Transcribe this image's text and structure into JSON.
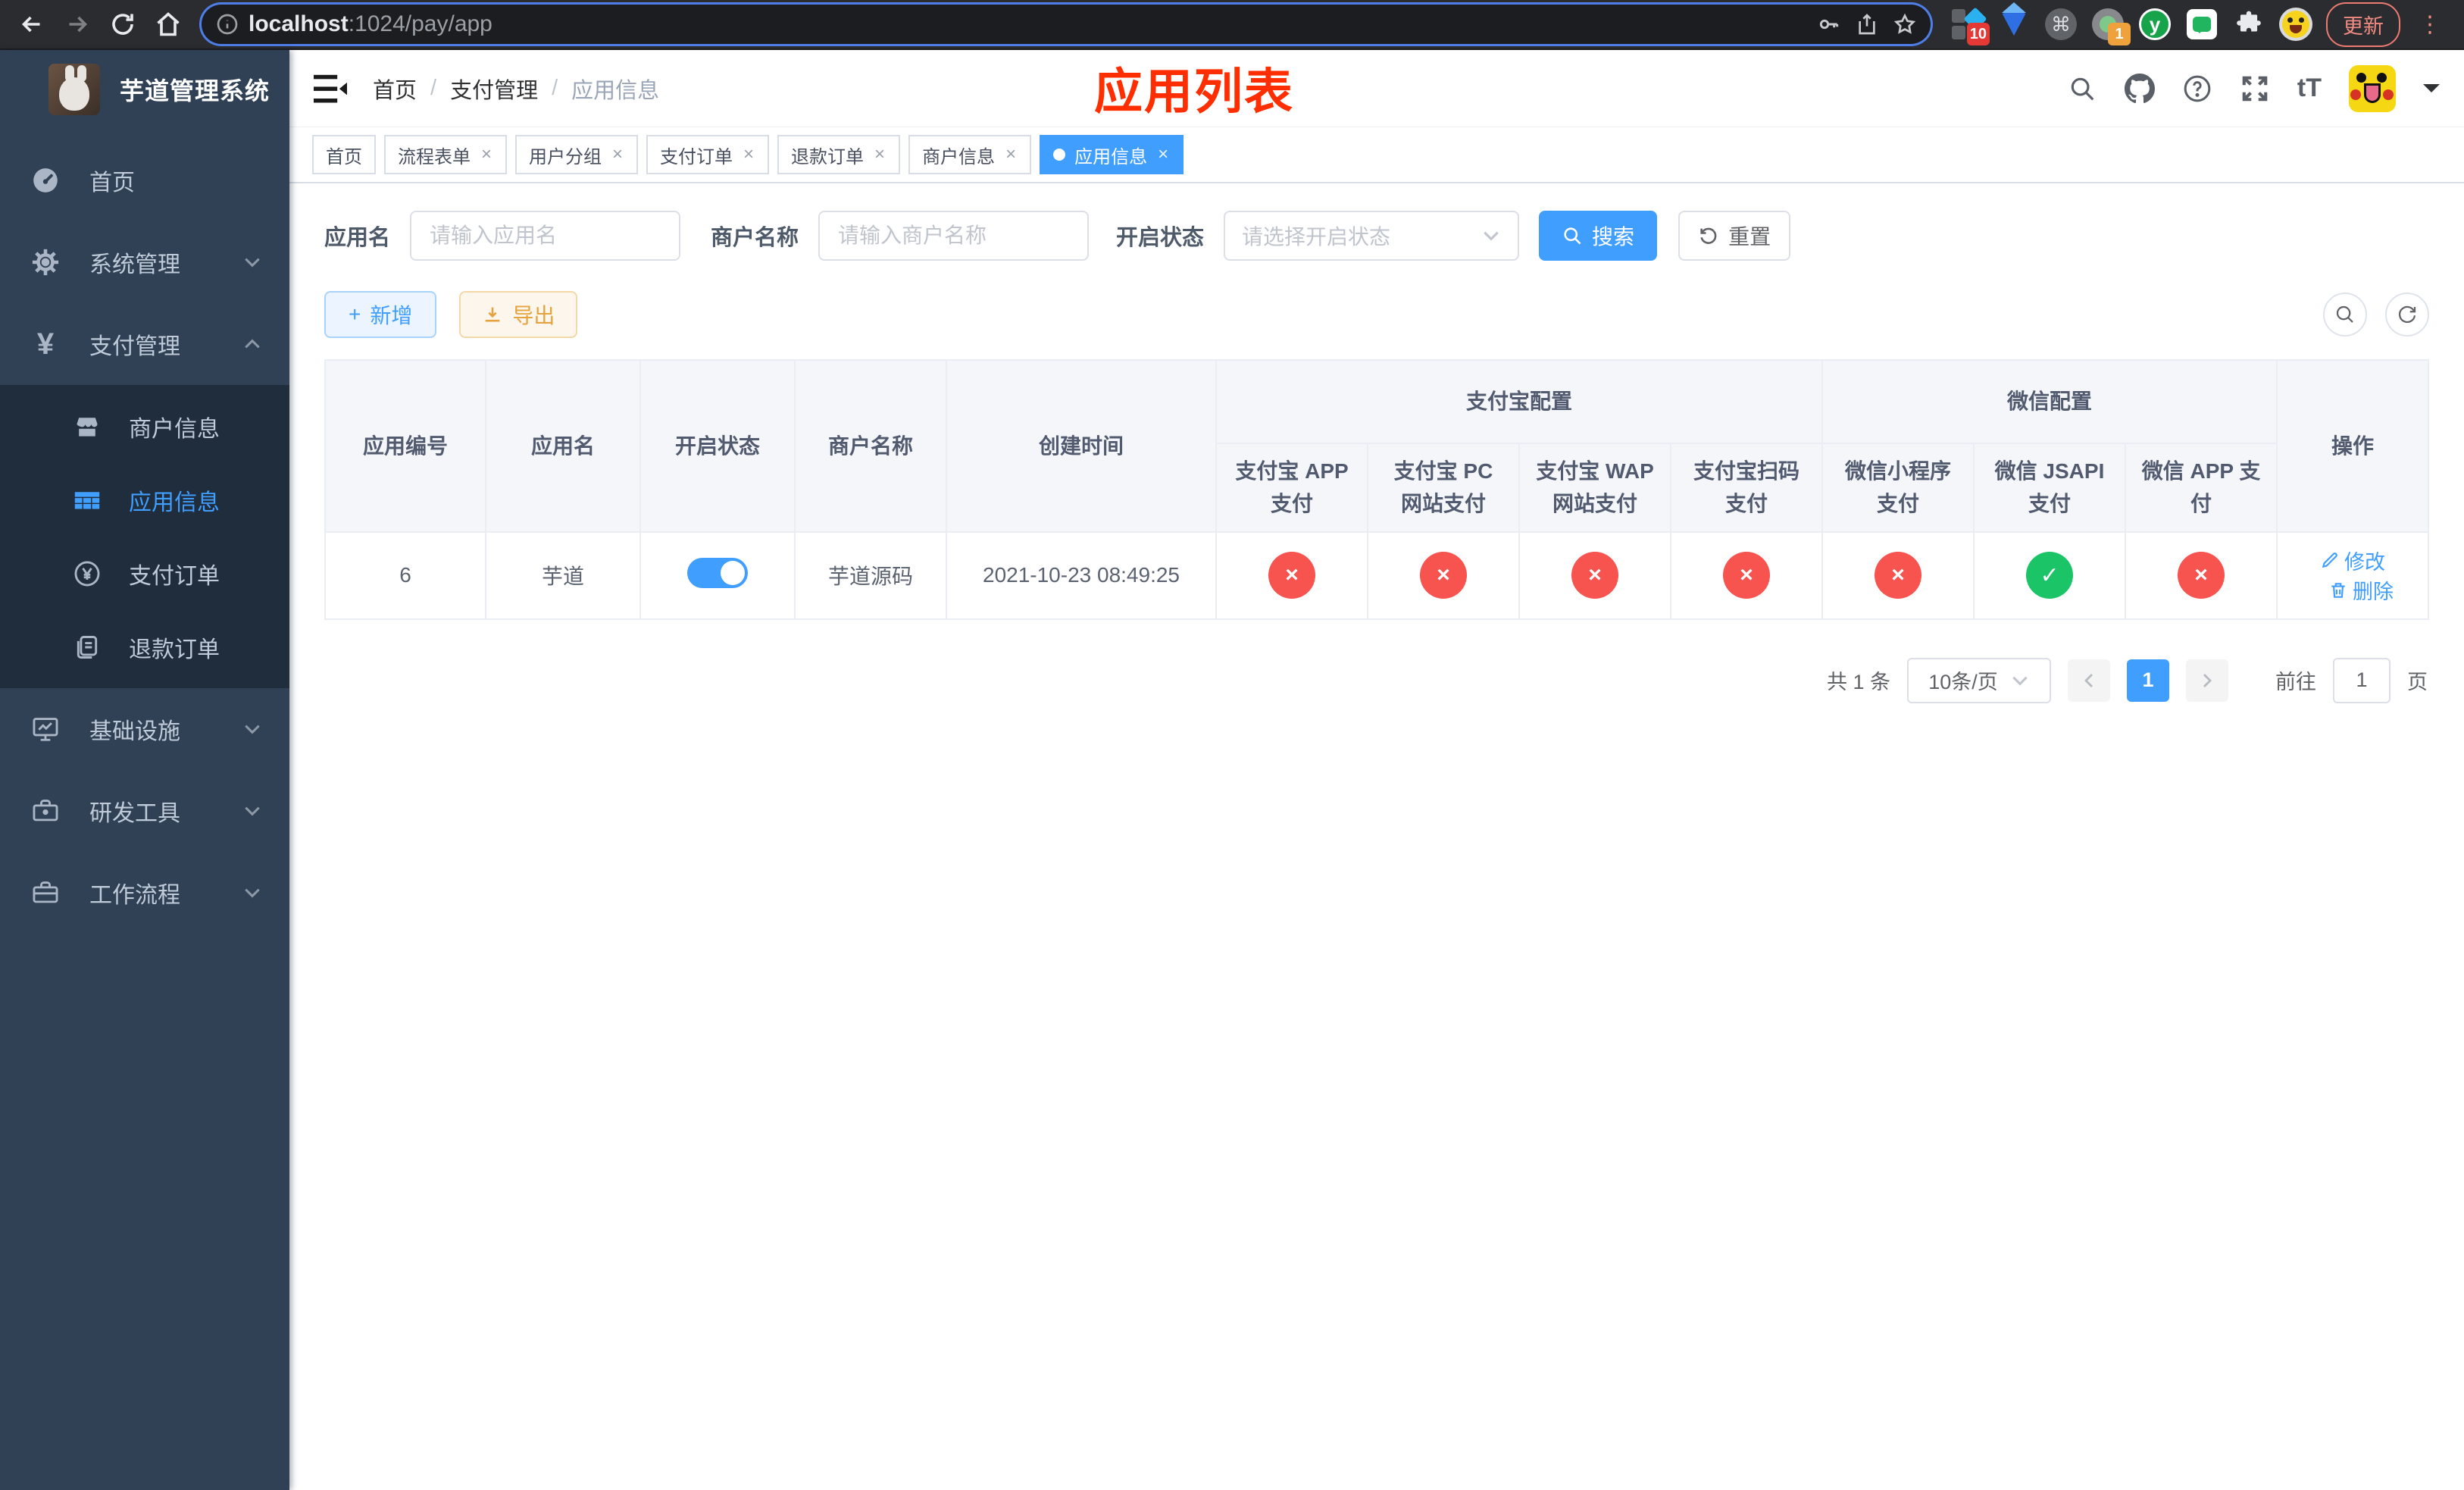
{
  "browser": {
    "url_host": "localhost",
    "url_path": ":1024/pay/app",
    "update_label": "更新",
    "pin_badge": "10",
    "proxy_badge": "1",
    "cmd_glyph": "⌘",
    "y_glyph": "y"
  },
  "icons": {
    "close": "×",
    "check": "✓",
    "cross": "×",
    "yen": "¥",
    "plus": "+",
    "question": "?",
    "info": "i",
    "font_size": "tT"
  },
  "colors": {
    "accent": "#409eff",
    "danger": "#f7534f",
    "success": "#1cc468",
    "annotation": "#ff2e00",
    "sidebar_bg": "#304156",
    "submenu_bg": "#1f2d3d"
  },
  "sidebar": {
    "title": "芋道管理系统",
    "items": [
      {
        "label": "首页"
      },
      {
        "label": "系统管理"
      },
      {
        "label": "支付管理"
      },
      {
        "label": "基础设施"
      },
      {
        "label": "研发工具"
      },
      {
        "label": "工作流程"
      }
    ],
    "submenu": [
      {
        "label": "商户信息"
      },
      {
        "label": "应用信息"
      },
      {
        "label": "支付订单"
      },
      {
        "label": "退款订单"
      }
    ]
  },
  "header": {
    "breadcrumb": [
      "首页",
      "支付管理",
      "应用信息"
    ],
    "separator": "/",
    "page_annotation": "应用列表"
  },
  "tabs": [
    "首页",
    "流程表单",
    "用户分组",
    "支付订单",
    "退款订单",
    "商户信息",
    "应用信息"
  ],
  "filters": {
    "app_name_label": "应用名",
    "app_name_placeholder": "请输入应用名",
    "merchant_label": "商户名称",
    "merchant_placeholder": "请输入商户名称",
    "status_label": "开启状态",
    "status_placeholder": "请选择开启状态",
    "search_label": "搜索",
    "reset_label": "重置"
  },
  "toolbar": {
    "add_label": "新增",
    "export_label": "导出"
  },
  "table": {
    "columns": [
      "应用编号",
      "应用名",
      "开启状态",
      "商户名称",
      "创建时间"
    ],
    "groups": [
      {
        "label": "支付宝配置",
        "children": [
          "支付宝 APP 支付",
          "支付宝 PC 网站支付",
          "支付宝 WAP 网站支付",
          "支付宝扫码支付"
        ]
      },
      {
        "label": "微信配置",
        "children": [
          "微信小程序支付",
          "微信 JSAPI 支付",
          "微信 APP 支付"
        ]
      }
    ],
    "action_label": "操作",
    "rows": [
      {
        "id": "6",
        "name": "芋道",
        "enabled": true,
        "merchant_name": "芋道源码",
        "create_time": "2021-10-23 08:49:25",
        "statuses": [
          "no",
          "no",
          "no",
          "no",
          "no",
          "yes",
          "no"
        ],
        "edit_label": "修改",
        "delete_label": "删除"
      }
    ]
  },
  "pagination": {
    "total": "共 1 条",
    "page_size": "10条/页",
    "current_page": "1",
    "goto_label": "前往",
    "goto_value": "1",
    "page_unit": "页"
  }
}
